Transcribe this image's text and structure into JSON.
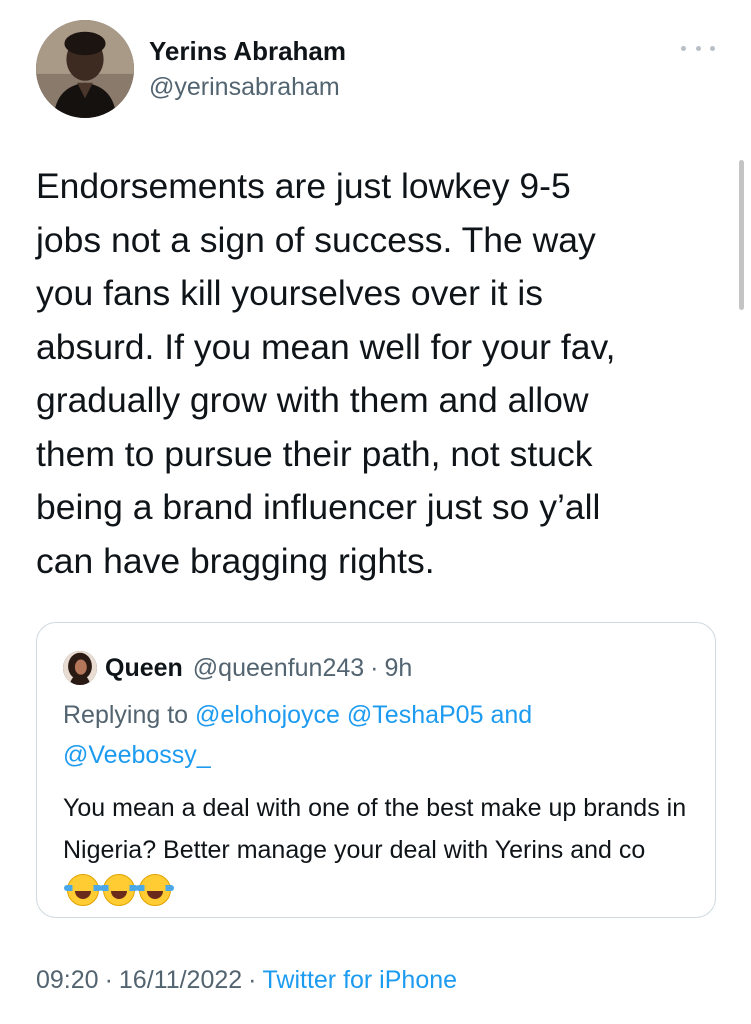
{
  "author": {
    "name": "Yerins Abraham",
    "handle": "@yerinsabraham",
    "avatar_icon": "user-avatar"
  },
  "more_icon": "more-horizontal-icon",
  "tweet": {
    "text": "Endorsements are just lowkey 9-5\njobs not a sign of success. The way\nyou fans kill yourselves over it is\nabsurd. If you mean well for your fav,\ngradually grow with them and allow\nthem to pursue their path, not stuck\nbeing a brand influencer just so y’all\ncan have bragging rights."
  },
  "quote": {
    "name": "Queen",
    "handle": "@queenfun243",
    "dot": "·",
    "time": "9h",
    "replying_label": "Replying to",
    "reply_handles": [
      "@elohojoyce",
      "@TeshaP05"
    ],
    "reply_and": "and",
    "reply_handle_last": "@Veebossy_",
    "text": "You mean a deal with one of the best make up brands in Nigeria? Better manage your deal with Yerins and co",
    "emoji_icon": "face-with-tears-of-joy-icon",
    "emoji_count": 3
  },
  "footer": {
    "time": "09:20",
    "sep": "·",
    "date": "16/11/2022",
    "source": "Twitter for iPhone"
  },
  "colors": {
    "link": "#1d9bf0",
    "secondary_text": "#536471",
    "primary_text": "#0f1419",
    "border": "#cfd9de"
  }
}
